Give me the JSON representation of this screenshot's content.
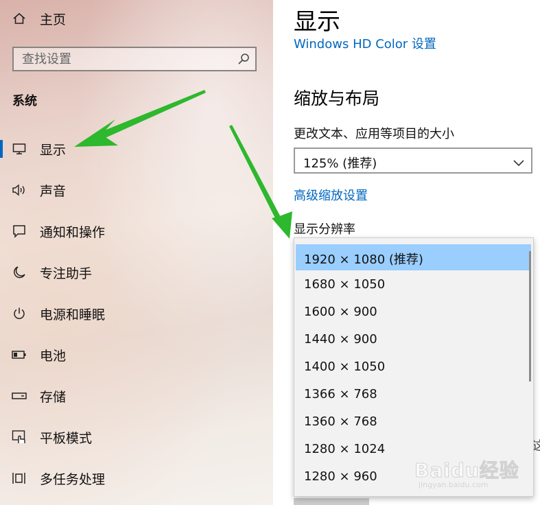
{
  "sidebar": {
    "home_label": "主页",
    "search_placeholder": "查找设置",
    "section_title": "系统",
    "items": [
      {
        "label": "显示",
        "icon": "monitor-icon",
        "active": true
      },
      {
        "label": "声音",
        "icon": "speaker-icon"
      },
      {
        "label": "通知和操作",
        "icon": "notification-icon"
      },
      {
        "label": "专注助手",
        "icon": "moon-icon"
      },
      {
        "label": "电源和睡眠",
        "icon": "power-icon"
      },
      {
        "label": "电池",
        "icon": "battery-icon"
      },
      {
        "label": "存储",
        "icon": "storage-icon"
      },
      {
        "label": "平板模式",
        "icon": "tablet-icon"
      },
      {
        "label": "多任务处理",
        "icon": "multitask-icon"
      }
    ]
  },
  "main": {
    "title": "显示",
    "hdr_link": "Windows HD Color 设置",
    "scale_section_title": "缩放与布局",
    "scale_label": "更改文本、应用等项目的大小",
    "scale_value": "125% (推荐)",
    "advanced_scaling_link": "高级缩放设置",
    "resolution_label": "显示分辨率",
    "partial_text": "这"
  },
  "resolution_dropdown": {
    "selected_index": 0,
    "options": [
      "1920 × 1080 (推荐)",
      "1680 × 1050",
      "1600 × 900",
      "1440 × 900",
      "1400 × 1050",
      "1366 × 768",
      "1360 × 768",
      "1280 × 1024",
      "1280 × 960"
    ]
  },
  "watermark": {
    "main": "Baidu经验",
    "sub": "jingyan.baidu.com"
  },
  "colors": {
    "accent": "#0067c0",
    "selected_option": "#99ceff",
    "annotation_arrow": "#2db82d"
  }
}
